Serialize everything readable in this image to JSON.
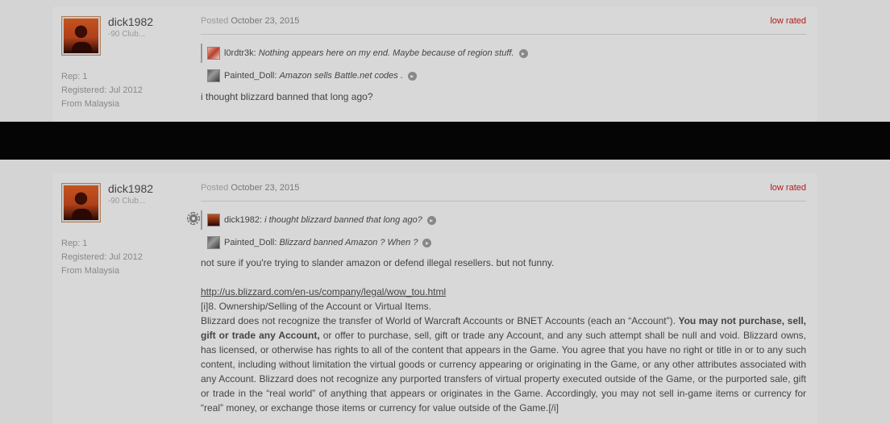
{
  "posts": [
    {
      "username": "dick1982",
      "usertitle": "-90 Club...",
      "rep": "Rep: 1",
      "registered": "Registered: Jul 2012",
      "from": "From Malaysia",
      "posted_label": "Posted",
      "posted_date": "October 23, 2015",
      "rating": "low rated",
      "quotes": [
        {
          "name": "l0rdtr3k:",
          "text": "Nothing appears here on my end. Maybe because of region stuff.",
          "avatar": "lord"
        },
        {
          "name": "Painted_Doll:",
          "text": "Amazon sells Battle.net codes .",
          "avatar": "painted"
        }
      ],
      "body": "i thought blizzard banned that long ago?"
    },
    {
      "username": "dick1982",
      "usertitle": "-90 Club...",
      "rep": "Rep: 1",
      "registered": "Registered: Jul 2012",
      "from": "From Malaysia",
      "posted_label": "Posted",
      "posted_date": "October 23, 2015",
      "rating": "low rated",
      "quotes": [
        {
          "name": "dick1982:",
          "text": "i thought blizzard banned that long ago?",
          "avatar": "dick"
        },
        {
          "name": "Painted_Doll:",
          "text": "Blizzard banned Amazon ? When ?",
          "avatar": "painted"
        }
      ],
      "body_intro": "not sure if you're trying to slander amazon or defend illegal resellers. but not funny.",
      "link": "http://us.blizzard.com/en-us/company/legal/wow_tou.html",
      "section": "[i]8. Ownership/Selling of the Account or Virtual Items.",
      "para_before_bold": "Blizzard does not recognize the transfer of World of Warcraft Accounts or BNET Accounts (each an “Account”). ",
      "para_bold": "You may not purchase, sell, gift or trade any Account,",
      "para_after_bold": " or offer to purchase, sell, gift or trade any Account, and any such attempt shall be null and void. Blizzard owns, has licensed, or otherwise has rights to all of the content that appears in the Game. You agree that you have no right or title in or to any such content, including without limitation the virtual goods or currency appearing or originating in the Game, or any other attributes associated with any Account. Blizzard does not recognize any purported transfers of virtual property executed outside of the Game, or the purported sale, gift or trade in the “real world” of anything that appears or originates in the Game. Accordingly, you may not sell in-game items or currency for “real” money, or exchange those items or currency for value outside of the Game.[/i]"
    }
  ],
  "icons": {
    "quote_go": "arrow-right-circle-icon",
    "options": "gear-icon"
  }
}
